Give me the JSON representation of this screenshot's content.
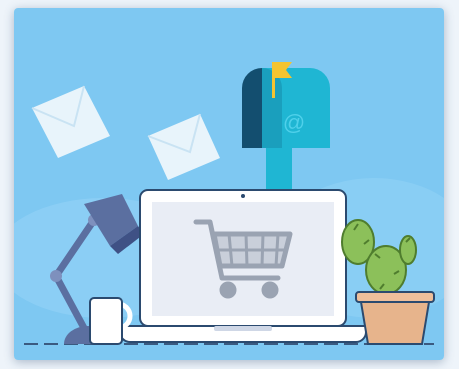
{
  "illustration": {
    "kind": "ecommerce-email-marketing",
    "mailbox_symbol": "@",
    "colors": {
      "background": "#7ec8f2",
      "background_light": "#a8dcf8",
      "mailbox": "#1fb6d3",
      "mailbox_dark": "#134e6f",
      "flag": "#f4c430",
      "laptop_frame": "#ffffff",
      "laptop_screen": "#e9edf5",
      "cart": "#9aa3b2",
      "lamp": "#5b6fa0",
      "cactus": "#8cc05a",
      "pot": "#e7b48c",
      "envelope": "#e8f4fb"
    }
  }
}
